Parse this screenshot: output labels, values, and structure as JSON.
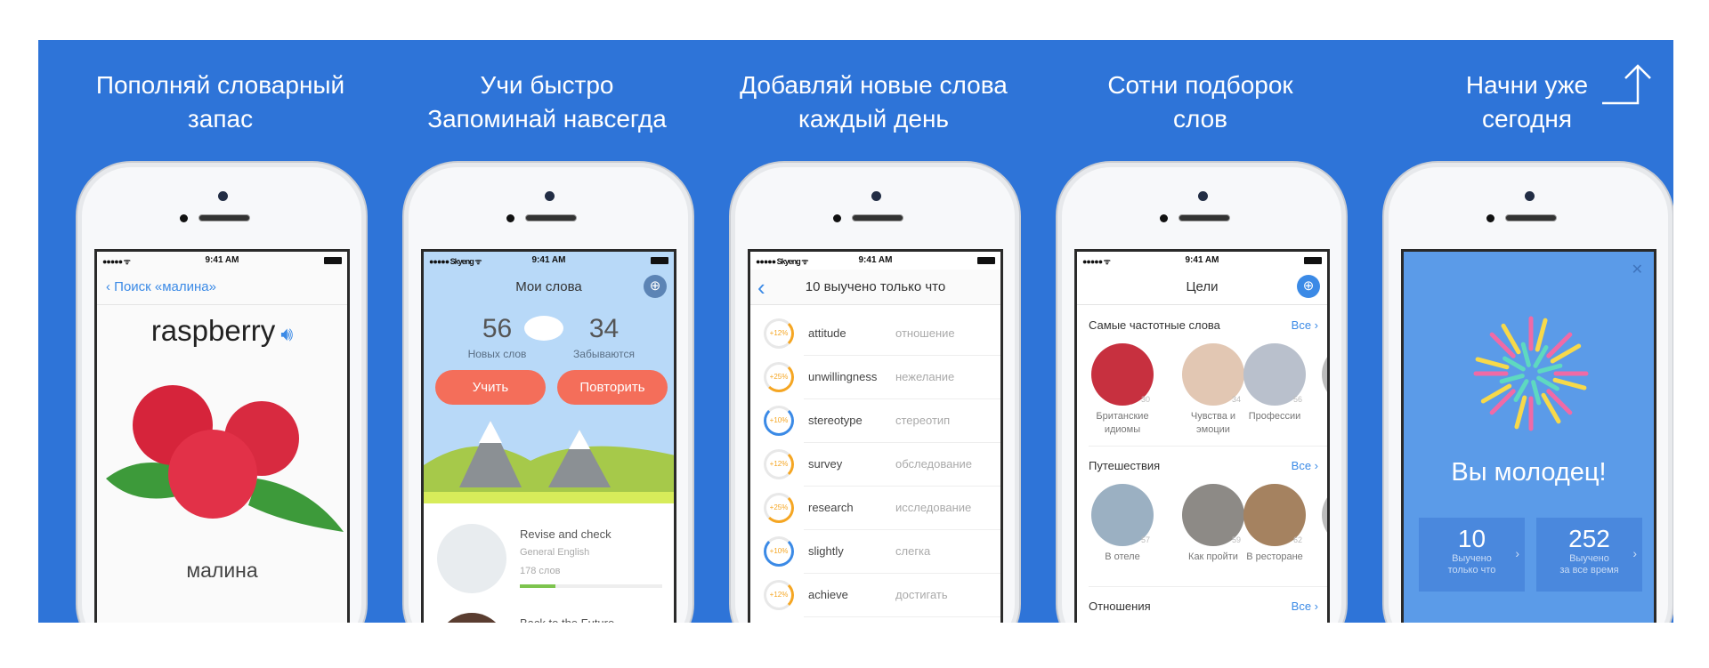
{
  "colors": {
    "background": "#2e74d8",
    "accent": "#3b8ae6",
    "button": "#f46e5a",
    "success_screen": "#5b9be8"
  },
  "header_icon": "share-arrow-icon",
  "columns": [
    {
      "title": [
        "Пополняй словарный",
        "запас"
      ]
    },
    {
      "title": [
        "Учи быстро",
        "Запоминай навсегда"
      ]
    },
    {
      "title": [
        "Добавляй новые слова",
        "каждый день"
      ]
    },
    {
      "title": [
        "Сотни подборок",
        "слов"
      ]
    },
    {
      "title": [
        "Начни уже",
        "сегодня"
      ]
    }
  ],
  "status": {
    "signal": "●●●●●",
    "carrier": "Skyeng",
    "time": "9:41 AM"
  },
  "screen1": {
    "back": "Поиск «малина»",
    "word": "raspberry",
    "translation": "малина",
    "sound_icon": "speaker-icon"
  },
  "screen2": {
    "title": "Мои слова",
    "new_count": "56",
    "new_label": "Новых слов",
    "forget_count": "34",
    "forget_label": "Забываются",
    "learn": "Учить",
    "repeat": "Повторить",
    "courses": [
      {
        "title": "Revise and check",
        "subtitle": "General English",
        "count": "178 слов",
        "progress": 0.25
      },
      {
        "title": "Back to the Future"
      }
    ]
  },
  "screen3": {
    "title": "10 выучено только что",
    "words": [
      {
        "w": "attitude",
        "t": "отношение",
        "p": "+12%"
      },
      {
        "w": "unwillingness",
        "t": "нежелание",
        "p": "+25%"
      },
      {
        "w": "stereotype",
        "t": "стереотип",
        "p": "+10%"
      },
      {
        "w": "survey",
        "t": "обследование",
        "p": "+12%"
      },
      {
        "w": "research",
        "t": "исследование",
        "p": "+25%"
      },
      {
        "w": "slightly",
        "t": "слегка",
        "p": "+10%"
      },
      {
        "w": "achieve",
        "t": "достигать",
        "p": "+12%"
      }
    ]
  },
  "screen4": {
    "title": "Цели",
    "all": "Все ›",
    "sections": [
      {
        "name": "Самые частотные слова",
        "items": [
          {
            "label": "Британские идиомы",
            "n": "30"
          },
          {
            "label": "Чувства и эмоции",
            "n": "34"
          },
          {
            "label": "Профессии",
            "n": "56"
          }
        ]
      },
      {
        "name": "Путешествия",
        "items": [
          {
            "label": "В отеле",
            "n": "57"
          },
          {
            "label": "Как пройти",
            "n": "59"
          },
          {
            "label": "В ресторане",
            "n": "62"
          }
        ]
      },
      {
        "name": "Отношения",
        "items": []
      }
    ]
  },
  "screen5": {
    "title": "Вы молодец!",
    "stats": [
      {
        "n": "10",
        "l1": "Выучено",
        "l2": "только что"
      },
      {
        "n": "252",
        "l1": "Выучено",
        "l2": "за все время"
      }
    ]
  }
}
